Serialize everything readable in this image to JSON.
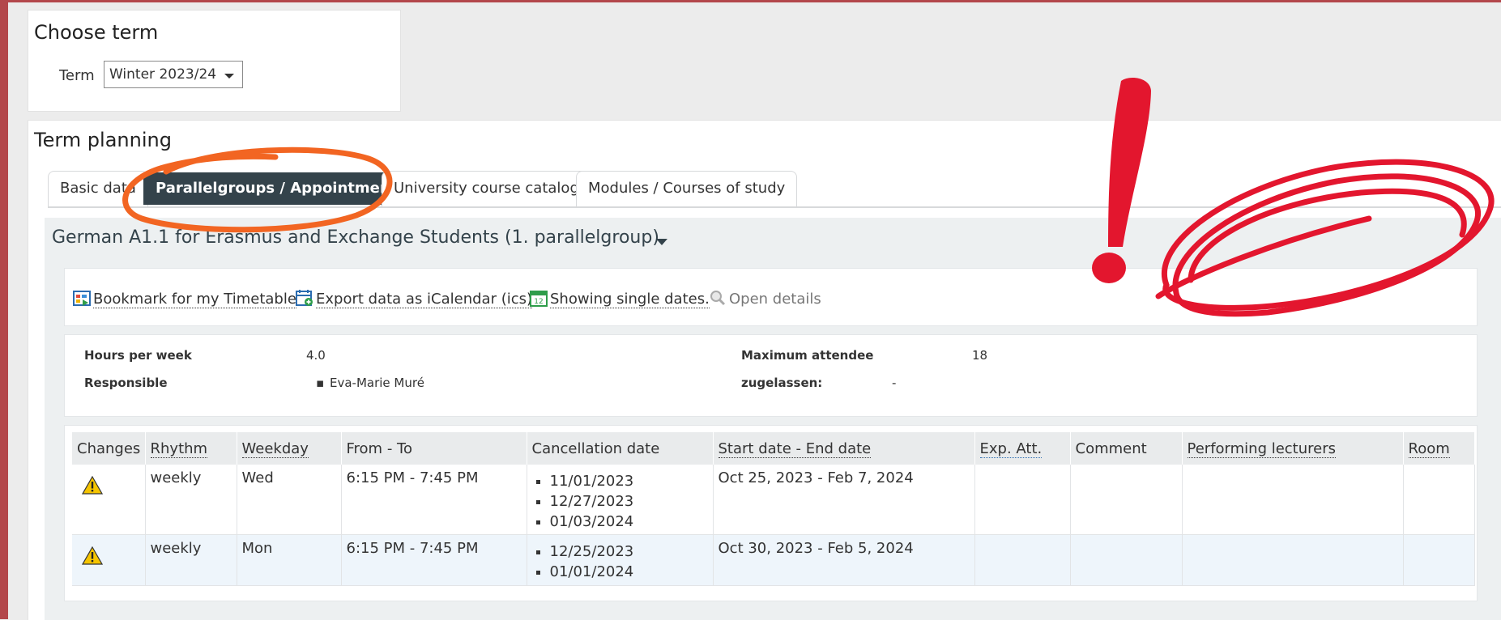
{
  "choose_term": {
    "title": "Choose term",
    "term_label": "Term",
    "term_value": "Winter 2023/24"
  },
  "planning": {
    "title": "Term planning",
    "tabs": [
      {
        "label": "Basic data",
        "active": false
      },
      {
        "label": "Parallelgroups / Appointments",
        "active": true
      },
      {
        "label": "University course catalog",
        "active": false
      },
      {
        "label": "Modules / Courses of study",
        "active": false
      }
    ]
  },
  "group": {
    "title": "German A1.1 for Erasmus and Exchange Students (1. parallelgroup)",
    "actions": {
      "bookmark": "Bookmark for my Timetable",
      "export": "Export data as iCalendar (ics)",
      "single_dates": "Showing single dates.",
      "open_details": "Open details"
    },
    "info": {
      "hours_label": "Hours per week",
      "hours_value": "4.0",
      "max_label": "Maximum attendee",
      "max_value": "18",
      "responsible_label": "Responsible",
      "responsible_value": "Eva-Marie Muré",
      "admitted_label": "zugelassen:",
      "admitted_value": "-"
    },
    "table": {
      "headers": [
        "Changes",
        "Rhythm",
        "Weekday",
        "From - To",
        "Cancellation date",
        "Start date - End date",
        "Exp. Att.",
        "Comment",
        "Performing lecturers",
        "Room"
      ],
      "rows": [
        {
          "rhythm": "weekly",
          "weekday": "Wed",
          "time": "6:15 PM - 7:45 PM",
          "cancellations": [
            "11/01/2023",
            "12/27/2023",
            "01/03/2024"
          ],
          "period": "Oct 25, 2023 - Feb 7, 2024"
        },
        {
          "rhythm": "weekly",
          "weekday": "Mon",
          "time": "6:15 PM - 7:45 PM",
          "cancellations": [
            "12/25/2023",
            "01/01/2024"
          ],
          "period": "Oct 30, 2023 - Feb 5, 2024"
        }
      ]
    }
  },
  "colors": {
    "accent": "#34434b",
    "annotation_orange": "#f26522",
    "annotation_red": "#e3162e",
    "warning_yellow": "#f5c400"
  }
}
